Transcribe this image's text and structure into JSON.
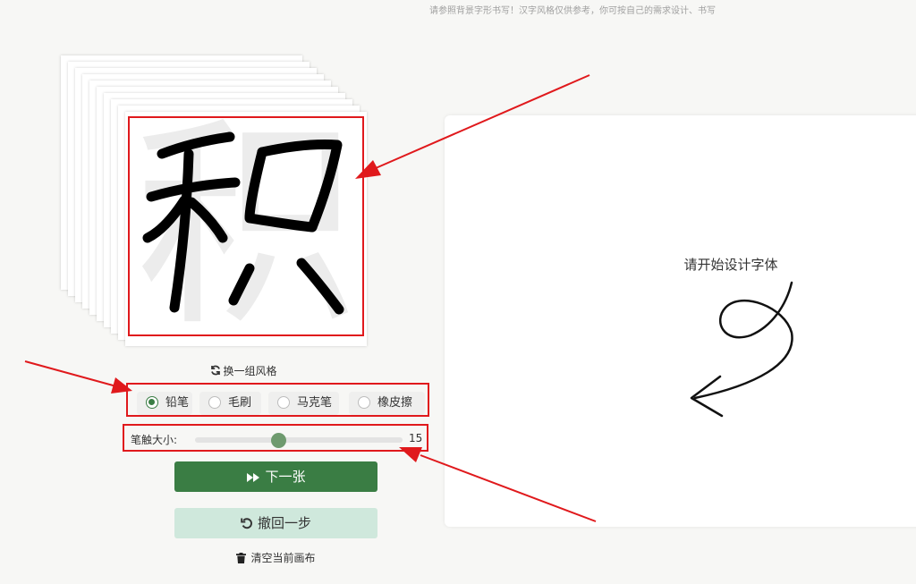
{
  "hint_text": "请参照背景字形书写！汉字风格仅供参考，你可按自己的需求设计、书写",
  "reference": {
    "glyph": "积"
  },
  "swap_style_label": "换一组风格",
  "tools": {
    "pencil": {
      "label": "铅笔",
      "selected": true
    },
    "brush": {
      "label": "毛刷",
      "selected": false
    },
    "marker": {
      "label": "马克笔",
      "selected": false
    },
    "eraser": {
      "label": "橡皮擦",
      "selected": false
    }
  },
  "brush_size": {
    "label": "笔触大小:",
    "value": "15",
    "fraction": 0.4
  },
  "buttons": {
    "next": "下一张",
    "undo": "撤回一步",
    "clear": "清空当前画布"
  },
  "canvas": {
    "prompt": "请开始设计字体"
  },
  "colors": {
    "accent_green": "#3a7d44",
    "light_green": "#cfe8dc",
    "annotation_red": "#e0191c"
  }
}
